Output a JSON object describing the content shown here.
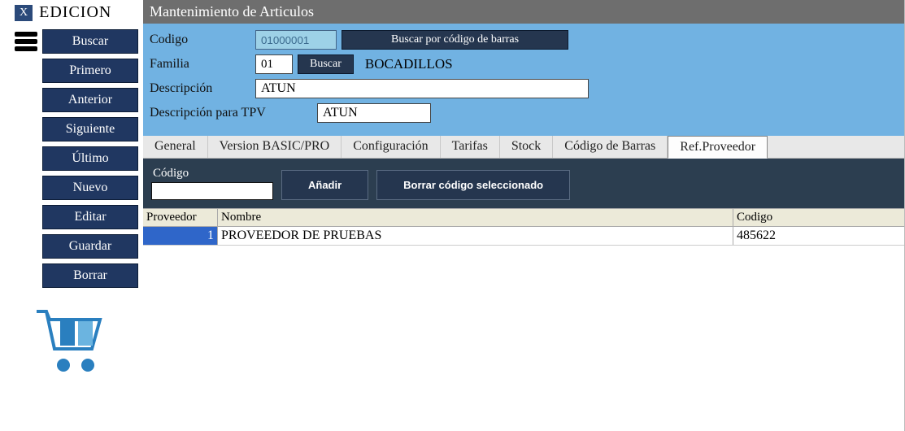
{
  "sidebar": {
    "badge": "X",
    "mode": "EDICION",
    "buscar": "Buscar",
    "items": [
      "Primero",
      "Anterior",
      "Siguiente",
      "Último",
      "Nuevo",
      "Editar",
      "Guardar",
      "Borrar"
    ]
  },
  "header": {
    "title": "Mantenimiento de Articulos"
  },
  "form": {
    "codigo_label": "Codigo",
    "codigo_value": "01000001",
    "buscar_barras": "Buscar por código de barras",
    "familia_label": "Familia",
    "familia_value": "01",
    "buscar_btn": "Buscar",
    "familia_text": "BOCADILLOS",
    "descripcion_label": "Descripción",
    "descripcion_value": "ATUN",
    "desc_tpv_label": "Descripción para TPV",
    "desc_tpv_value": "ATUN"
  },
  "tabs": [
    "General",
    "Version BASIC/PRO",
    "Configuración",
    "Tarifas",
    "Stock",
    "Código de Barras",
    "Ref.Proveedor"
  ],
  "active_tab": 6,
  "toolbar": {
    "codigo_label": "Código",
    "anadir": "Añadir",
    "borrar": "Borrar código seleccionado"
  },
  "grid": {
    "headers": {
      "proveedor": "Proveedor",
      "nombre": "Nombre",
      "codigo": "Codigo"
    },
    "rows": [
      {
        "proveedor": "1",
        "nombre": "PROVEEDOR DE PRUEBAS",
        "codigo": "485622"
      }
    ]
  }
}
